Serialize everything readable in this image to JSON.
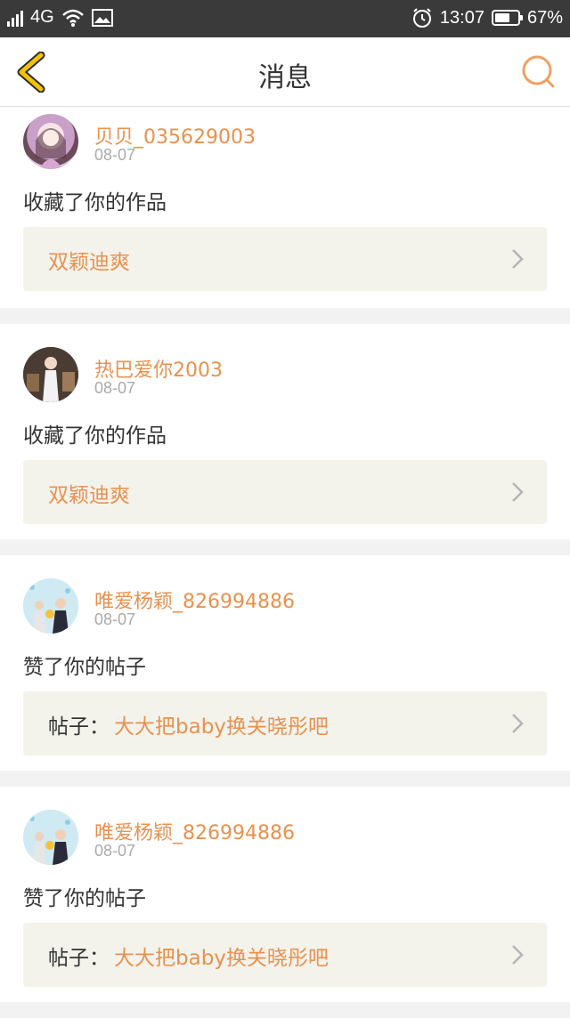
{
  "status_bar": {
    "network": "4G",
    "time": "13:07",
    "battery": "67%",
    "battery_level": 0.67
  },
  "nav": {
    "title": "消息"
  },
  "messages": [
    {
      "username": "贝贝_035629003",
      "date": "08-07",
      "action": "收藏了你的作品",
      "link_label": "",
      "link_title": "双颖迪爽"
    },
    {
      "username": "热巴爱你2003",
      "date": "08-07",
      "action": "收藏了你的作品",
      "link_label": "",
      "link_title": "双颖迪爽"
    },
    {
      "username": "唯爱杨颖_826994886",
      "date": "08-07",
      "action": "赞了你的帖子",
      "link_label": "帖子：",
      "link_title": "大大把baby换关晓彤吧"
    },
    {
      "username": "唯爱杨颖_826994886",
      "date": "08-07",
      "action": "赞了你的帖子",
      "link_label": "帖子：",
      "link_title": "大大把baby换关晓彤吧"
    }
  ],
  "colors": {
    "accent": "#e9914e",
    "back_icon": "#f2c300",
    "link_bg": "#f3f3ec"
  }
}
